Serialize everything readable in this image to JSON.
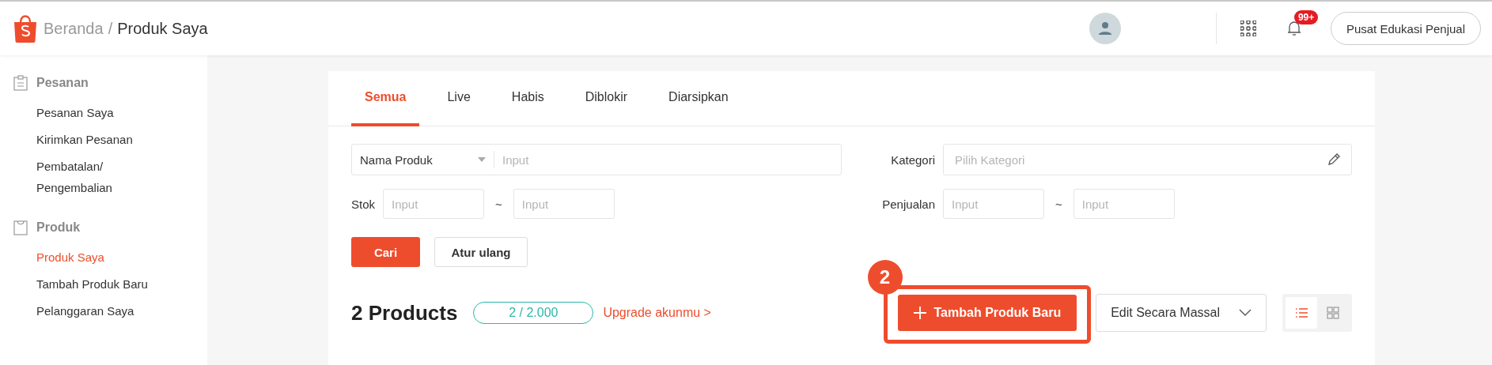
{
  "header": {
    "breadcrumb_separator": "/",
    "breadcrumb": [
      {
        "label": "Beranda",
        "current": false
      },
      {
        "label": "Produk Saya",
        "current": true
      }
    ],
    "notification_badge": "99+",
    "help_button": "Pusat Edukasi Penjual"
  },
  "sidebar": {
    "sections": [
      {
        "title": "Pesanan",
        "items": [
          {
            "label": "Pesanan Saya",
            "selected": false
          },
          {
            "label": "Kirimkan Pesanan",
            "selected": false
          },
          {
            "label": "Pembatalan/\nPengembalian",
            "selected": false
          }
        ]
      },
      {
        "title": "Produk",
        "items": [
          {
            "label": "Produk Saya",
            "selected": true
          },
          {
            "label": "Tambah Produk Baru",
            "selected": false
          },
          {
            "label": "Pelanggaran Saya",
            "selected": false
          }
        ]
      }
    ]
  },
  "tabs": [
    {
      "label": "Semua",
      "selected": true
    },
    {
      "label": "Live",
      "selected": false
    },
    {
      "label": "Habis",
      "selected": false
    },
    {
      "label": "Diblokir",
      "selected": false
    },
    {
      "label": "Diarsipkan",
      "selected": false
    }
  ],
  "filters": {
    "search_type": "Nama Produk",
    "search": {
      "placeholder": "Input"
    },
    "stock": {
      "label": "Stok",
      "min_placeholder": "Input",
      "separator": "~",
      "max_placeholder": "Input"
    },
    "category": {
      "label": "Kategori",
      "placeholder": "Pilih Kategori"
    },
    "sales": {
      "label": "Penjualan",
      "min_placeholder": "Input",
      "separator": "~",
      "max_placeholder": "Input"
    },
    "buttons": [
      {
        "label": "Cari",
        "kind": "primary"
      },
      {
        "label": "Atur ulang",
        "kind": "secondary"
      }
    ]
  },
  "products": {
    "title": "2 Products",
    "quota": "2 / 2.000",
    "upgrade_link": "Upgrade akunmu >",
    "add_button": "Tambah Produk Baru",
    "bulk_edit": "Edit Secara Massal",
    "view_modes": [
      {
        "kind": "list",
        "selected": true
      },
      {
        "kind": "grid",
        "selected": false
      }
    ]
  },
  "annotation": {
    "step": "2"
  }
}
